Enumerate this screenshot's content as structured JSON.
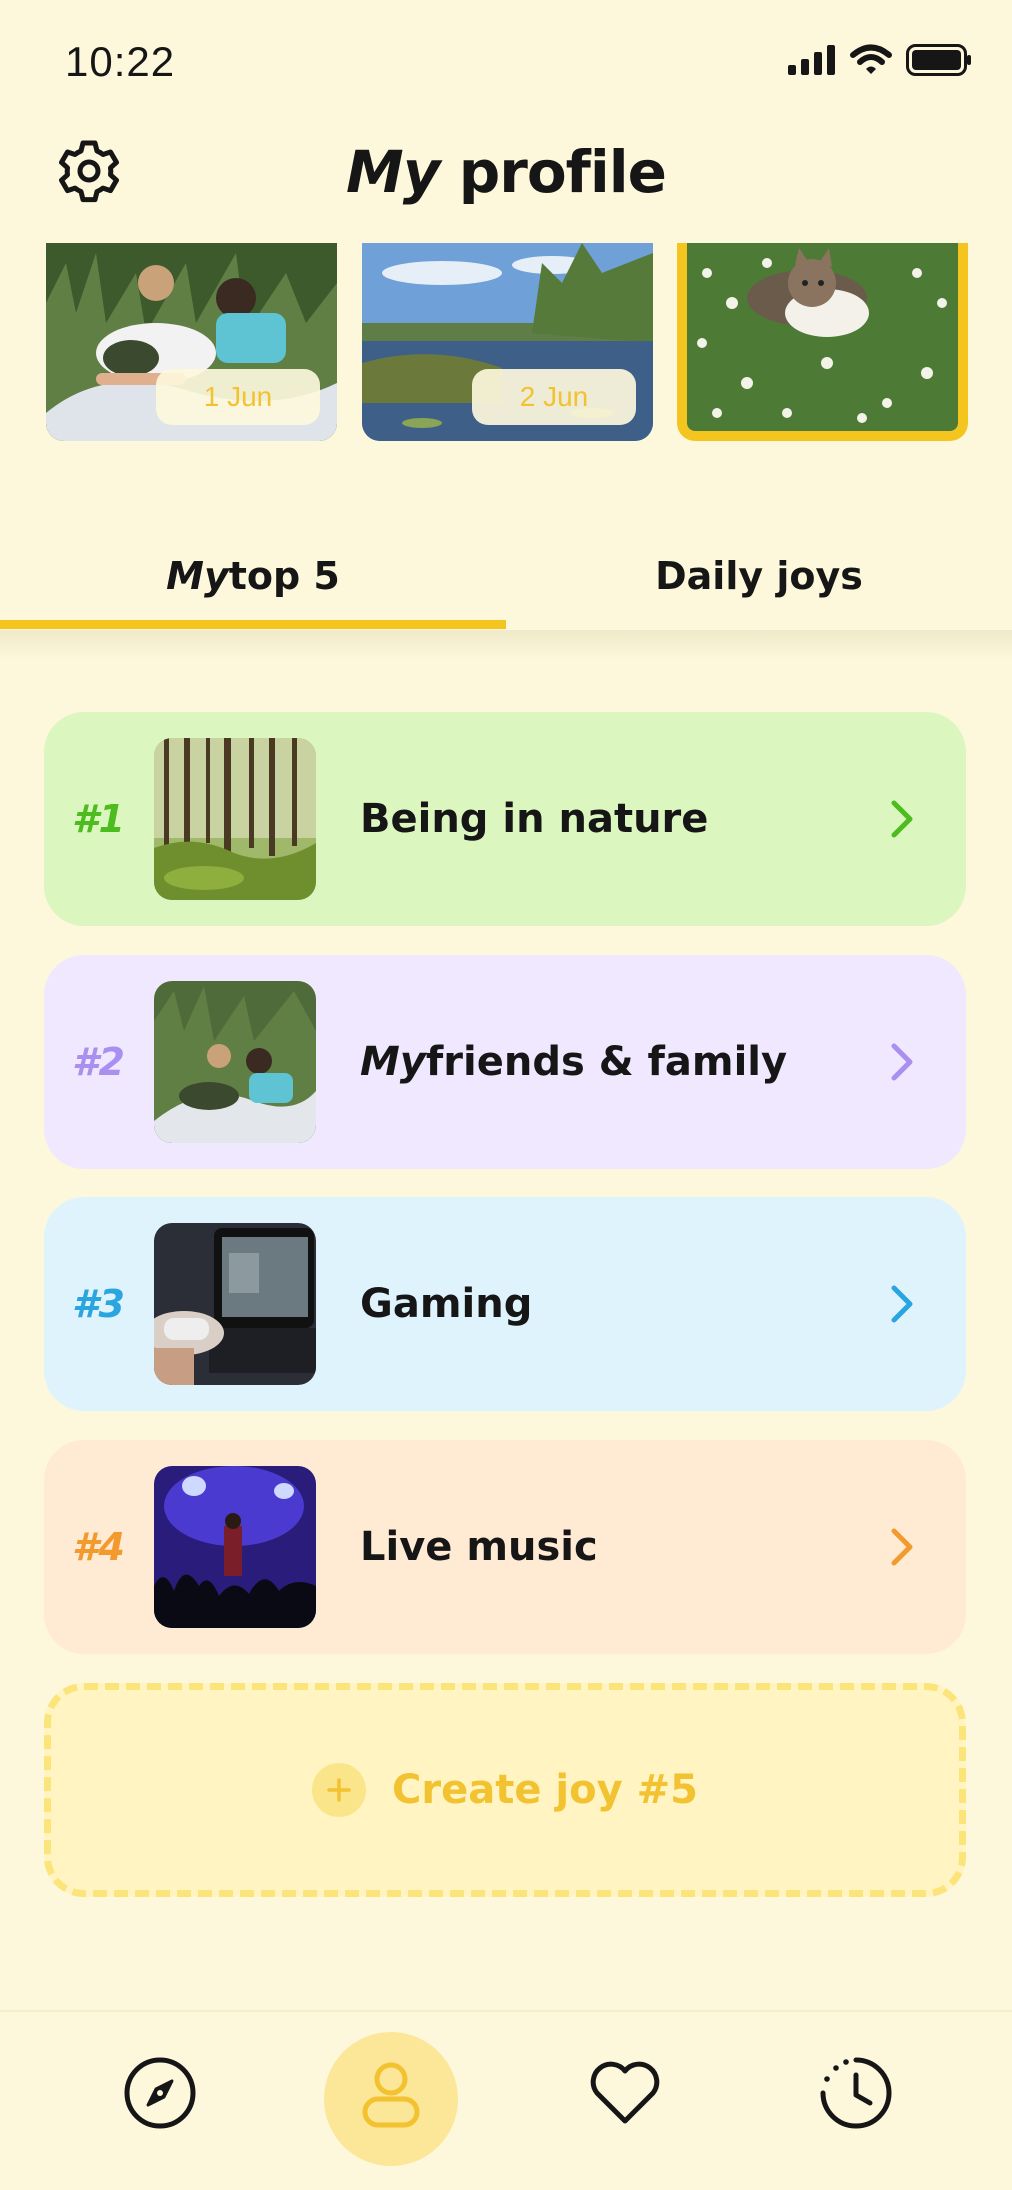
{
  "status_bar": {
    "time": "10:22"
  },
  "header": {
    "title_part1": "My",
    "title_part2": " profile"
  },
  "photos": [
    {
      "date": "1 Jun",
      "selected": false
    },
    {
      "date": "2 Jun",
      "selected": false
    },
    {
      "date": "",
      "selected": true
    }
  ],
  "tabs": [
    {
      "label_part1": "My",
      "label_part2": " top 5",
      "active": true
    },
    {
      "label": "Daily joys",
      "active": false
    }
  ],
  "joys": [
    {
      "rank": "#1",
      "title": "Being in nature",
      "bg": "#dcf6bf",
      "accent": "#4cbc1f"
    },
    {
      "rank": "#2",
      "title_part1": "My",
      "title_part2": " friends & family",
      "bg": "#efe8ff",
      "accent": "#a88ff0"
    },
    {
      "rank": "#3",
      "title": "Gaming",
      "bg": "#dff3fd",
      "accent": "#2aa5e0"
    },
    {
      "rank": "#4",
      "title": "Live music",
      "bg": "#ffead3",
      "accent": "#f29a2e"
    }
  ],
  "create": {
    "label": "Create joy #5"
  },
  "nav": {
    "items": [
      "compass-icon",
      "profile-icon",
      "heart-icon",
      "history-icon"
    ],
    "active": "profile-icon"
  },
  "colors": {
    "background": "#fdf7dc",
    "accent": "#f4c51e"
  }
}
